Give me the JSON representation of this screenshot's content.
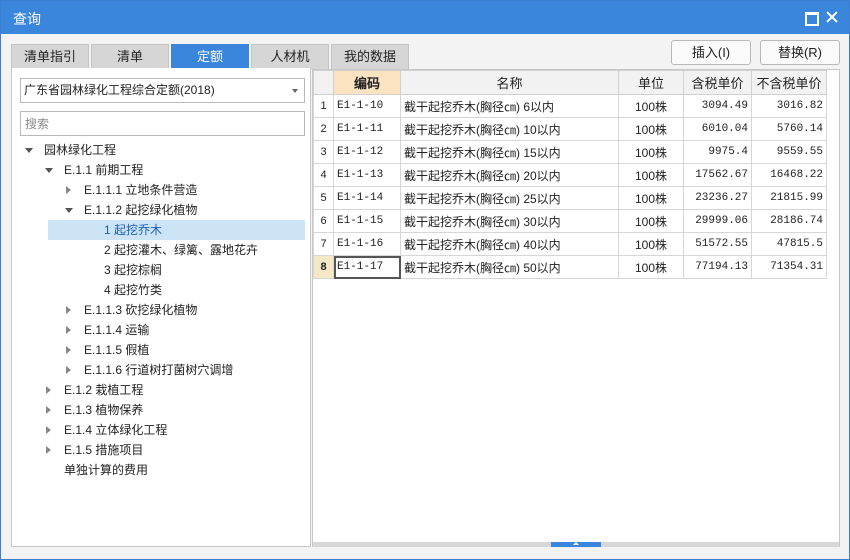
{
  "window": {
    "title": "查询"
  },
  "tabs": [
    {
      "label": "清单指引"
    },
    {
      "label": "清单"
    },
    {
      "label": "定额",
      "active": true
    },
    {
      "label": "人材机"
    },
    {
      "label": "我的数据"
    }
  ],
  "actions": {
    "insert_label": "插入(I)",
    "replace_label": "替换(R)"
  },
  "quota_library": {
    "selected": "广东省园林绿化工程综合定额(2018)"
  },
  "search": {
    "placeholder": "搜索",
    "value": ""
  },
  "tree": [
    {
      "label": "园林绿化工程",
      "expander": "down"
    },
    {
      "label": "E.1.1 前期工程",
      "expander": "down"
    },
    {
      "label": "E.1.1.1 立地条件营造",
      "expander": "right"
    },
    {
      "label": "E.1.1.2 起挖绿化植物",
      "expander": "down"
    },
    {
      "label": "1 起挖乔木",
      "expander": "none",
      "selected": true
    },
    {
      "label": "2 起挖灌木、绿篱、露地花卉",
      "expander": "none"
    },
    {
      "label": "3 起挖棕榈",
      "expander": "none"
    },
    {
      "label": "4 起挖竹类",
      "expander": "none"
    },
    {
      "label": "E.1.1.3 砍挖绿化植物",
      "expander": "right"
    },
    {
      "label": "E.1.1.4 运输",
      "expander": "right"
    },
    {
      "label": "E.1.1.5 假植",
      "expander": "right"
    },
    {
      "label": "E.1.1.6 行道树打菌树穴调增",
      "expander": "right"
    },
    {
      "label": "E.1.2 栽植工程",
      "expander": "right"
    },
    {
      "label": "E.1.3 植物保养",
      "expander": "right"
    },
    {
      "label": "E.1.4 立体绿化工程",
      "expander": "right"
    },
    {
      "label": "E.1.5 措施项目",
      "expander": "right"
    },
    {
      "label": "单独计算的费用",
      "expander": "none"
    }
  ],
  "grid": {
    "columns": [
      "",
      "编码",
      "名称",
      "单位",
      "含税单价",
      "不含税单价"
    ],
    "rows": [
      {
        "idx": "1",
        "code": "E1-1-10",
        "name": "截干起挖乔木(胸径㎝) 6以内",
        "unit": "100株",
        "price_tax": "3094.49",
        "price_notax": "3016.82"
      },
      {
        "idx": "2",
        "code": "E1-1-11",
        "name": "截干起挖乔木(胸径㎝) 10以内",
        "unit": "100株",
        "price_tax": "6010.04",
        "price_notax": "5760.14"
      },
      {
        "idx": "3",
        "code": "E1-1-12",
        "name": "截干起挖乔木(胸径㎝) 15以内",
        "unit": "100株",
        "price_tax": "9975.4",
        "price_notax": "9559.55"
      },
      {
        "idx": "4",
        "code": "E1-1-13",
        "name": "截干起挖乔木(胸径㎝) 20以内",
        "unit": "100株",
        "price_tax": "17562.67",
        "price_notax": "16468.22"
      },
      {
        "idx": "5",
        "code": "E1-1-14",
        "name": "截干起挖乔木(胸径㎝) 25以内",
        "unit": "100株",
        "price_tax": "23236.27",
        "price_notax": "21815.99"
      },
      {
        "idx": "6",
        "code": "E1-1-15",
        "name": "截干起挖乔木(胸径㎝) 30以内",
        "unit": "100株",
        "price_tax": "29999.06",
        "price_notax": "28186.74"
      },
      {
        "idx": "7",
        "code": "E1-1-16",
        "name": "截干起挖乔木(胸径㎝) 40以内",
        "unit": "100株",
        "price_tax": "51572.55",
        "price_notax": "47815.5"
      },
      {
        "idx": "8",
        "code": "E1-1-17",
        "name": "截干起挖乔木(胸径㎝) 50以内",
        "unit": "100株",
        "price_tax": "77194.13",
        "price_notax": "71354.31",
        "current": true
      }
    ]
  }
}
